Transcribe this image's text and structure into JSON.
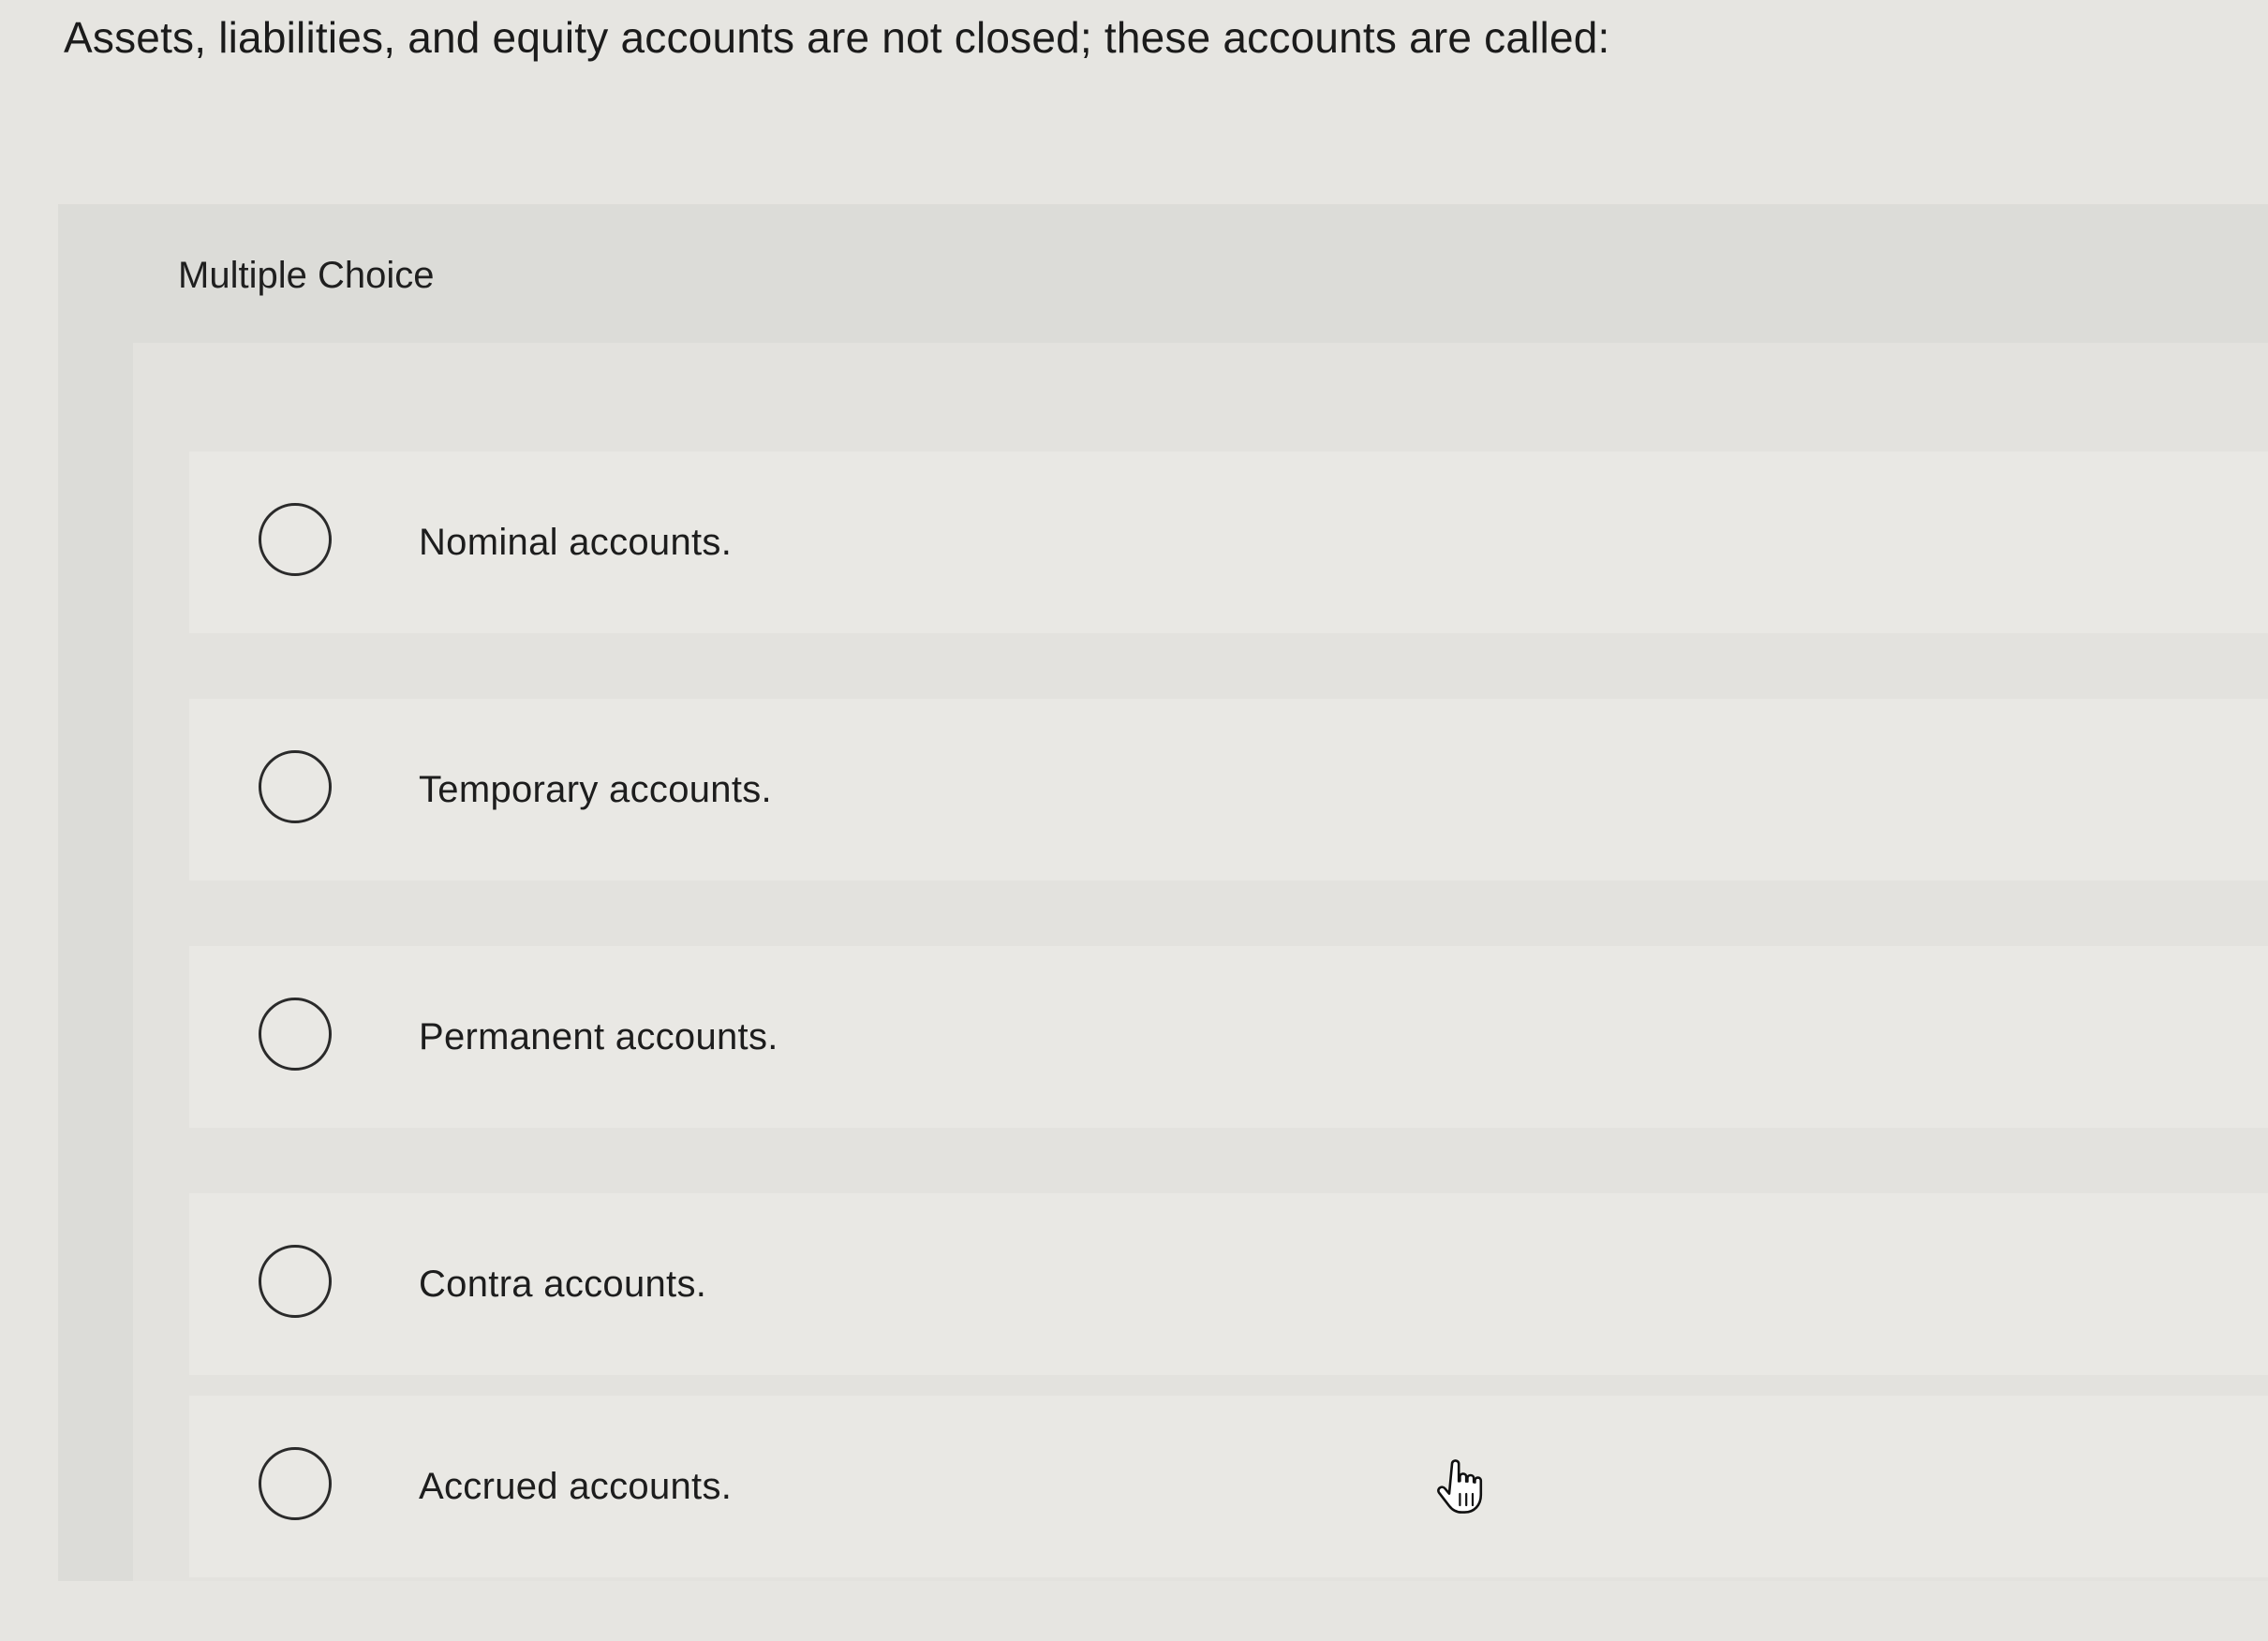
{
  "question": {
    "text": "Assets, liabilities, and equity accounts are not closed; these accounts are called:"
  },
  "panel": {
    "title": "Multiple Choice"
  },
  "options": [
    {
      "label": "Nominal accounts.",
      "selected": false
    },
    {
      "label": "Temporary accounts.",
      "selected": false
    },
    {
      "label": "Permanent accounts.",
      "selected": false
    },
    {
      "label": "Contra accounts.",
      "selected": false
    },
    {
      "label": "Accrued accounts.",
      "selected": false
    }
  ],
  "icons": {
    "radio": "radio-button-unchecked-icon",
    "cursor": "hand-pointer-icon"
  },
  "colors": {
    "background": "#e6e5e1",
    "panel": "#dcdcd8",
    "option_background": "#e9e8e4",
    "text": "#1e1e1e",
    "radio_border": "#2a2a2a"
  }
}
